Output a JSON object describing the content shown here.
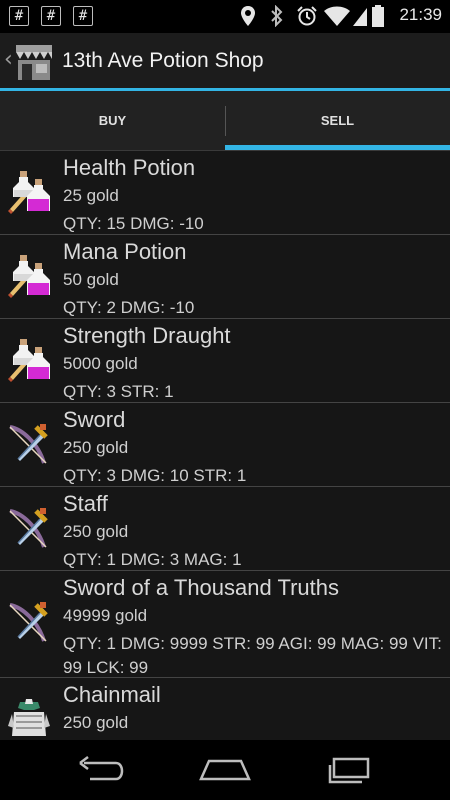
{
  "statusbar": {
    "notifications": [
      "#",
      "#",
      "#"
    ],
    "icons": [
      "location-icon",
      "bluetooth-icon",
      "alarm-icon",
      "wifi-icon",
      "signal-icon",
      "battery-icon"
    ],
    "time": "21:39"
  },
  "actionbar": {
    "title": "13th Ave Potion Shop",
    "icon": "shop-icon"
  },
  "tabs": [
    {
      "label": "BUY",
      "selected": false
    },
    {
      "label": "SELL",
      "selected": true
    }
  ],
  "items": [
    {
      "name": "Health Potion",
      "price": "25 gold",
      "stats": "QTY: 15 DMG: -10",
      "icon": "potion-icon"
    },
    {
      "name": "Mana Potion",
      "price": "50 gold",
      "stats": "QTY: 2 DMG: -10",
      "icon": "potion-icon"
    },
    {
      "name": "Strength Draught",
      "price": "5000 gold",
      "stats": "QTY: 3 STR: 1",
      "icon": "potion-icon"
    },
    {
      "name": "Sword",
      "price": "250 gold",
      "stats": "QTY: 3 DMG: 10 STR: 1",
      "icon": "weapon-icon"
    },
    {
      "name": "Staff",
      "price": "250 gold",
      "stats": "QTY: 1 DMG: 3 MAG: 1",
      "icon": "weapon-icon"
    },
    {
      "name": "Sword of a Thousand Truths",
      "price": "49999 gold",
      "stats": "QTY: 1 DMG: 9999 STR: 99 AGI: 99 MAG: 99 VIT: 99 LCK: 99",
      "icon": "weapon-icon"
    },
    {
      "name": "Chainmail",
      "price": "250 gold",
      "stats": "",
      "icon": "armor-icon"
    }
  ],
  "colors": {
    "accent": "#33b5e5",
    "background": "#161616",
    "actionbar": "#1c1c1c"
  }
}
